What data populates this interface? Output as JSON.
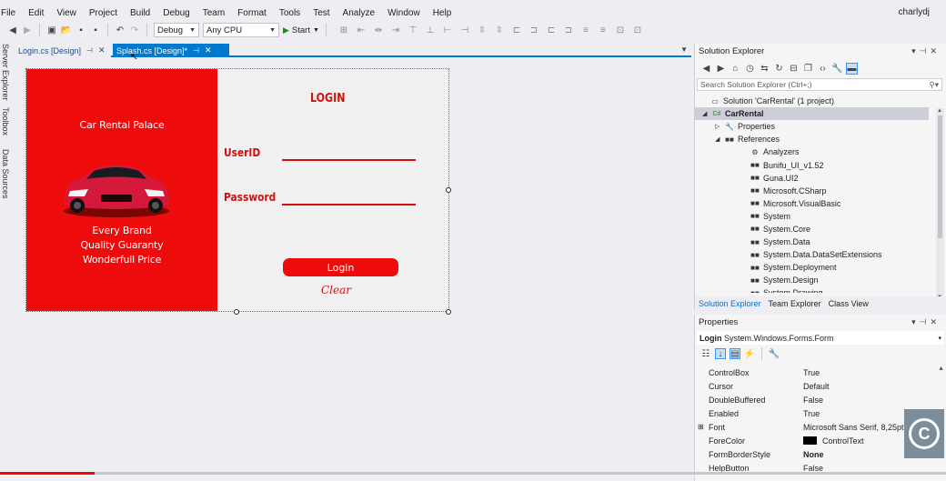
{
  "menu": [
    "File",
    "Edit",
    "View",
    "Project",
    "Build",
    "Debug",
    "Team",
    "Format",
    "Tools",
    "Test",
    "Analyze",
    "Window",
    "Help"
  ],
  "user": "charlydj",
  "toolbar": {
    "config": "Debug",
    "platform": "Any CPU",
    "start_label": "Start"
  },
  "side_tabs": [
    "Server Explorer",
    "Toolbox",
    "Data Sources"
  ],
  "doc_tabs": [
    {
      "label": "Login.cs [Design]",
      "active": false
    },
    {
      "label": "Splash.cs [Design]*",
      "active": true
    }
  ],
  "form": {
    "brand": "Car Rental Palace",
    "slogans": [
      "Every Brand",
      "Quality Guaranty",
      "Wonderfull Price"
    ],
    "title": "LOGIN",
    "userid_label": "UserID",
    "password_label": "Password",
    "login_button": "Login",
    "clear_link": "Clear",
    "panel_color": "#ee0b0b"
  },
  "solution_explorer": {
    "title": "Solution Explorer",
    "search_placeholder": "Search Solution Explorer (Ctrl+;)",
    "items": [
      {
        "label": "Solution 'CarRental' (1 project)",
        "icon": "solution-icon",
        "exp": ""
      },
      {
        "label": "CarRental",
        "icon": "csharp-project-icon",
        "exp": "◢",
        "selected": true
      },
      {
        "label": "Properties",
        "icon": "wrench-icon",
        "exp": "▷"
      },
      {
        "label": "References",
        "icon": "references-icon",
        "exp": "◢"
      },
      {
        "label": "Analyzers",
        "icon": "analyzer-icon",
        "exp": ""
      },
      {
        "label": "Bunifu_UI_v1.52",
        "icon": "reference-icon",
        "exp": ""
      },
      {
        "label": "Guna.UI2",
        "icon": "reference-icon",
        "exp": ""
      },
      {
        "label": "Microsoft.CSharp",
        "icon": "reference-icon",
        "exp": ""
      },
      {
        "label": "Microsoft.VisualBasic",
        "icon": "reference-icon",
        "exp": ""
      },
      {
        "label": "System",
        "icon": "reference-icon",
        "exp": ""
      },
      {
        "label": "System.Core",
        "icon": "reference-icon",
        "exp": ""
      },
      {
        "label": "System.Data",
        "icon": "reference-icon",
        "exp": ""
      },
      {
        "label": "System.Data.DataSetExtensions",
        "icon": "reference-icon",
        "exp": ""
      },
      {
        "label": "System.Deployment",
        "icon": "reference-icon",
        "exp": ""
      },
      {
        "label": "System.Design",
        "icon": "reference-icon",
        "exp": ""
      },
      {
        "label": "System.Drawing",
        "icon": "reference-icon",
        "exp": ""
      }
    ],
    "bottom_tabs": [
      "Solution Explorer",
      "Team Explorer",
      "Class View"
    ]
  },
  "properties": {
    "title": "Properties",
    "object_name": "Login",
    "object_type": "System.Windows.Forms.Form",
    "rows": [
      {
        "name": "ControlBox",
        "value": "True"
      },
      {
        "name": "Cursor",
        "value": "Default"
      },
      {
        "name": "DoubleBuffered",
        "value": "False"
      },
      {
        "name": "Enabled",
        "value": "True"
      },
      {
        "name": "Font",
        "value": "Microsoft Sans Serif, 8,25pt",
        "expandable": true
      },
      {
        "name": "ForeColor",
        "value": "ControlText",
        "swatch": "#000000"
      },
      {
        "name": "FormBorderStyle",
        "value": "None",
        "bold": true
      },
      {
        "name": "HelpButton",
        "value": "False"
      }
    ]
  },
  "video": {
    "progress": 0.1
  }
}
